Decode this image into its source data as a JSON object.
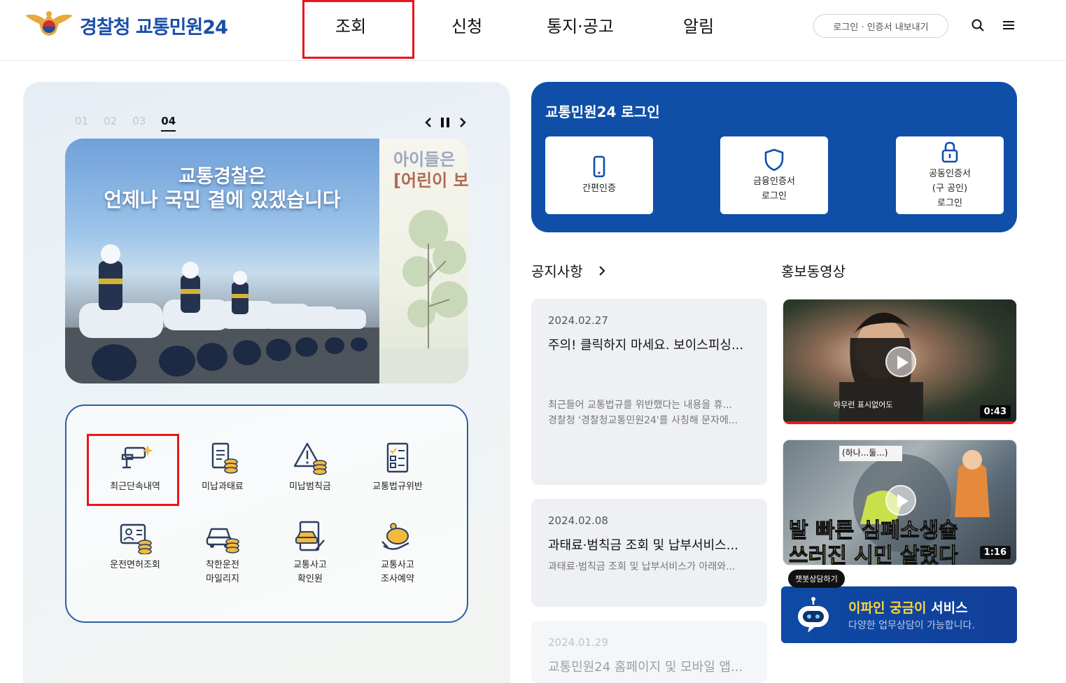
{
  "header": {
    "logo_text": "경찰청 교통민원24",
    "nav": [
      "조회",
      "신청",
      "통지·공고",
      "알림"
    ],
    "login_pill": "로그인 · 인증서 내보내기"
  },
  "slider": {
    "numbers": [
      "01",
      "02",
      "03",
      "04"
    ],
    "active_index": 4,
    "banner_line1": "교통경찰은",
    "banner_line2": "언제나 국민 곁에 있겠습니다",
    "side_line1": "아이들은",
    "side_line2": "[어린이 보"
  },
  "quick_menu": [
    {
      "label": "최근단속내역",
      "icon": "cctv-icon"
    },
    {
      "label": "미납과태료",
      "icon": "receipt-coins-icon"
    },
    {
      "label": "미납범칙금",
      "icon": "warning-coins-icon"
    },
    {
      "label": "교통법규위반",
      "icon": "checklist-icon"
    },
    {
      "label": "운전면허조회",
      "icon": "license-coins-icon"
    },
    {
      "label": "착한운전\n마일리지",
      "icon": "car-coins-icon"
    },
    {
      "label": "교통사고\n확인원",
      "icon": "car-document-icon"
    },
    {
      "label": "교통사고\n조사예약",
      "icon": "piggy-bank-icon"
    }
  ],
  "login": {
    "title": "교통민원24 로그인",
    "buttons": [
      {
        "label": "간편인증",
        "icon": "smartphone-icon"
      },
      {
        "label": "금융인증서\n로그인",
        "icon": "shield-icon"
      },
      {
        "label": "공동인증서\n(구 공인)\n로그인",
        "icon": "lock-icon"
      }
    ]
  },
  "notices": {
    "title": "공지사항",
    "items": [
      {
        "date": "2024.02.27",
        "title": "주의! 클릭하지 마세요. 보이스피싱...",
        "body1": "최근들어 교통법규를 위반했다는 내용을 휴...",
        "body2": "경찰청 '경찰청교통민원24'를 사칭해 문자에..."
      },
      {
        "date": "2024.02.08",
        "title": "과태료·범칙금 조회 및 납부서비스...",
        "body1": "과태료·범칙금 조회 및 납부서비스가 아래와...",
        "body2": ""
      },
      {
        "date": "2024.01.29",
        "title": "교통민원24 홈페이지 및 모바일 앱...",
        "body1": "",
        "body2": ""
      }
    ]
  },
  "videos": {
    "title": "홍보동영상",
    "items": [
      {
        "duration": "0:43",
        "caption": "아무런 표시없어도"
      },
      {
        "duration": "1:16",
        "caption_top": "발 빠른 심폐소생술",
        "caption_bottom": "쓰러진 시민 살렸다",
        "sign": "(하나...둘...)"
      }
    ]
  },
  "chatbot": {
    "badge": "챗봇상담하기",
    "title_highlight": "이파인 궁금이",
    "title_rest": " 서비스",
    "subtitle": "다양한 업무상담이 가능합니다."
  },
  "colors": {
    "brand_blue": "#0f4fa8",
    "highlight_red": "#e8161b",
    "chat_yellow": "#ffd43b"
  }
}
